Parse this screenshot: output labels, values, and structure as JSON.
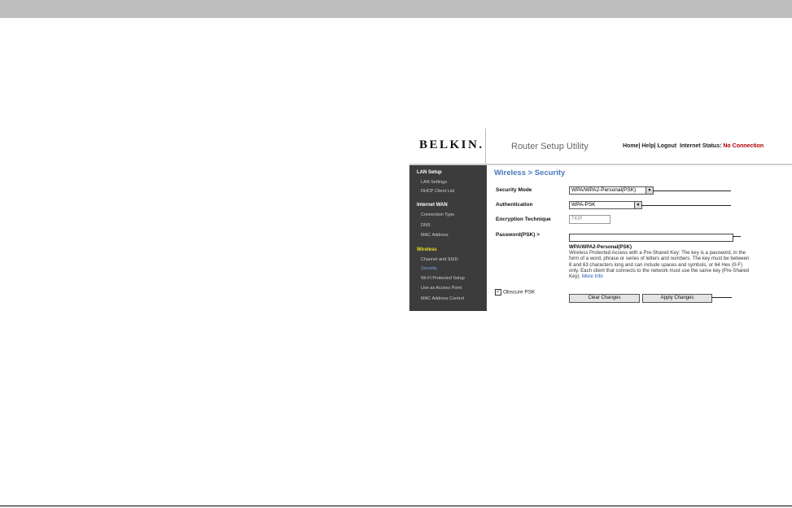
{
  "header": {
    "logo": "BELKIN.",
    "app_title": "Router Setup Utility",
    "links": {
      "home": "Home",
      "help": "Help",
      "logout": "Logout",
      "sep": "|",
      "status_label": "Internet Status:",
      "status_value": "No Connection"
    }
  },
  "sidebar": {
    "lan_setup": "LAN Setup",
    "lan_settings": "LAN Settings",
    "dhcp_client_list": "DHCP Client List",
    "internet_wan": "Internet WAN",
    "connection_type": "Connection Type",
    "dns": "DNS",
    "mac_address": "MAC Address",
    "wireless": "Wireless",
    "channel_ssid": "Channel and SSID",
    "security": "Security",
    "wps": "Wi-Fi Protected Setup",
    "access_point": "Use as Access Point",
    "mac_control": "MAC Address Control"
  },
  "main": {
    "title": "Wireless > Security",
    "security_mode_label": "Security Mode",
    "security_mode_value": "WPA/WPA2-Personal(PSK)",
    "authentication_label": "Authentication",
    "authentication_value": "WPA-PSK",
    "encryption_label": "Encryption Technique",
    "encryption_value": "TKIP",
    "password_label": "Password(PSK) >",
    "password_value": "",
    "desc_title": "WPA/WPA2-Personal(PSK)",
    "desc_body": "Wireless Protected Access with a Pre-Shared Key: The key is a password, in the form of a word, phrase or series of letters and numbers. The key must be between 8 and 63 characters long and can include spaces and symbols, or 64 Hex (0-F) only. Each client that connects to the network must use the same key (Pre-Shared Key).",
    "more_info": "More Info",
    "obscure_psk_label": "Obscure PSK",
    "obscure_psk_checked": true,
    "clear_button": "Clear Changes",
    "apply_button": "Apply Changes"
  },
  "colors": {
    "title_blue": "#4a77be",
    "status_red": "#b00000",
    "sidebar_bg": "#3c3c3c",
    "sidebar_highlight": "#e5e02a"
  }
}
